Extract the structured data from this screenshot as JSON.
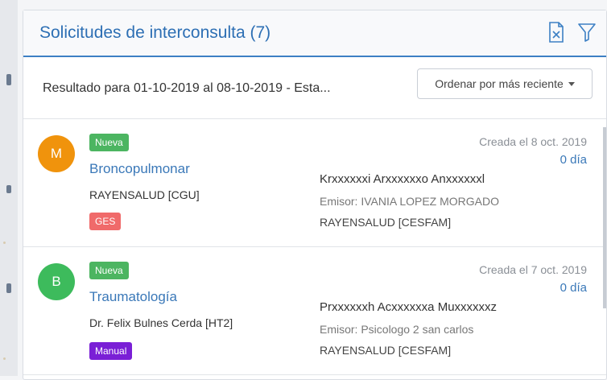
{
  "panel": {
    "title": "Solicitudes de interconsulta (7)",
    "icons": [
      "excel-export-icon",
      "filter-icon"
    ]
  },
  "filter": {
    "result_text": "Resultado para 01-10-2019 al 08-10-2019 - Esta...",
    "sort_label": "Ordenar por más reciente"
  },
  "requests": [
    {
      "avatar_letter": "M",
      "avatar_color": "#f0930c",
      "status": "Nueva",
      "status_color": "#4cb561",
      "specialty": "Broncopulmonar",
      "origin": "RAYENSALUD [CGU]",
      "tag": "GES",
      "tag_color": "#f06a6a",
      "created": "Creada el 8 oct. 2019",
      "days": "0 día",
      "patient": "Krxxxxxxi Arxxxxxxo Anxxxxxxl",
      "emisor": "Emisor: IVANIA LOPEZ MORGADO",
      "center": "RAYENSALUD [CESFAM]"
    },
    {
      "avatar_letter": "B",
      "avatar_color": "#3dbb5c",
      "status": "Nueva",
      "status_color": "#4cb561",
      "specialty": "Traumatología",
      "origin": "Dr. Felix Bulnes Cerda [HT2]",
      "tag": "Manual",
      "tag_color": "#7a1fd6",
      "created": "Creada el 7 oct. 2019",
      "days": "0 día",
      "patient": "Prxxxxxxh Acxxxxxxa Muxxxxxxz",
      "emisor": "Emisor: Psicologo 2 san carlos",
      "center": "RAYENSALUD [CESFAM]"
    }
  ]
}
